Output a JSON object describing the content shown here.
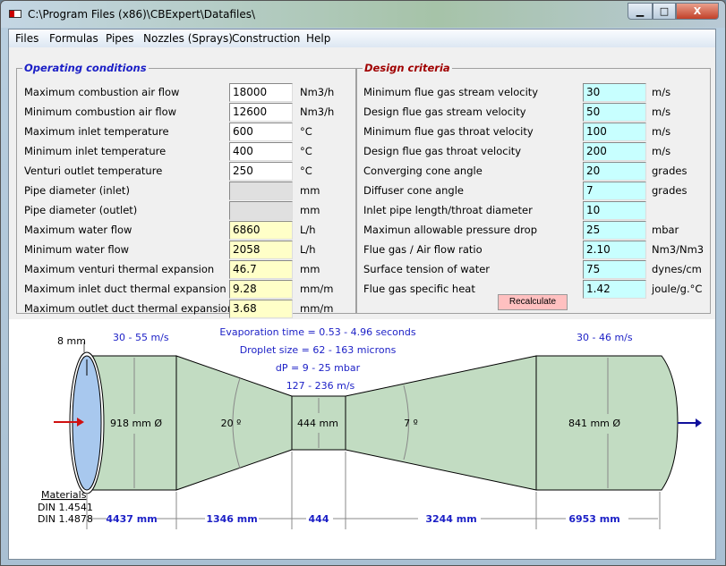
{
  "window": {
    "title": "C:\\Program Files (x86)\\CBExpert\\Datafiles\\",
    "minimize": "▁",
    "maximize": "□",
    "close": "X"
  },
  "menu": [
    "Files",
    "Formulas",
    "Pipes",
    "Nozzles (Sprays)",
    "Construction",
    "Help"
  ],
  "operating": {
    "title": "Operating conditions",
    "rows": [
      {
        "label": "Maximum combustion air flow",
        "value": "18000",
        "unit": "Nm3/h",
        "style": "white"
      },
      {
        "label": "Minimum combustion air flow",
        "value": "12600",
        "unit": "Nm3/h",
        "style": "white"
      },
      {
        "label": "Maximum inlet temperature",
        "value": "600",
        "unit": "°C",
        "style": "white"
      },
      {
        "label": "Minimum inlet temperature",
        "value": "400",
        "unit": "°C",
        "style": "white"
      },
      {
        "label": "Venturi outlet temperature",
        "value": "250",
        "unit": "°C",
        "style": "white"
      },
      {
        "label": "Pipe diameter (inlet)",
        "value": "",
        "unit": "mm",
        "style": "gray"
      },
      {
        "label": "Pipe diameter (outlet)",
        "value": "",
        "unit": "mm",
        "style": "gray"
      },
      {
        "label": "Maximum water flow",
        "value": "6860",
        "unit": "L/h",
        "style": "yellow"
      },
      {
        "label": "Minimum water flow",
        "value": "2058",
        "unit": "L/h",
        "style": "yellow"
      },
      {
        "label": "Maximum venturi thermal expansion",
        "value": "46.7",
        "unit": "mm",
        "style": "yellow"
      },
      {
        "label": "Maximum inlet duct thermal expansion",
        "value": "9.28",
        "unit": "mm/m",
        "style": "yellow"
      },
      {
        "label": "Maximum outlet duct thermal expansion",
        "value": "3.68",
        "unit": "mm/m",
        "style": "yellow"
      }
    ]
  },
  "design": {
    "title": "Design criteria",
    "rows": [
      {
        "label": "Minimum flue gas stream velocity",
        "value": "30",
        "unit": "m/s"
      },
      {
        "label": "Design flue gas stream velocity",
        "value": "50",
        "unit": "m/s"
      },
      {
        "label": "Minimum flue gas throat velocity",
        "value": "100",
        "unit": "m/s"
      },
      {
        "label": "Design flue gas throat velocity",
        "value": "200",
        "unit": "m/s"
      },
      {
        "label": "Converging cone angle",
        "value": "20",
        "unit": "grades"
      },
      {
        "label": "Diffuser cone angle",
        "value": "7",
        "unit": "grades"
      },
      {
        "label": "Inlet pipe length/throat diameter",
        "value": "10",
        "unit": ""
      },
      {
        "label": "Maximun allowable pressure drop",
        "value": "25",
        "unit": "mbar"
      },
      {
        "label": "Flue gas / Air flow ratio",
        "value": "2.10",
        "unit": "Nm3/Nm3"
      },
      {
        "label": "Surface tension of water",
        "value": "75",
        "unit": "dynes/cm"
      },
      {
        "label": "Flue gas specific heat",
        "value": "1.42",
        "unit": "joule/g.°C"
      }
    ],
    "recalculate": "Recalculate"
  },
  "diagram": {
    "wall": "8 mm",
    "inlet_velocity": "30 - 55 m/s",
    "outlet_velocity": "30 - 46 m/s",
    "evaporation": "Evaporation time = 0.53 - 4.96 seconds",
    "droplet": "Droplet size = 62 - 163 microns",
    "dp": "dP = 9 - 25 mbar",
    "throat_velocity": "127 - 236 m/s",
    "inlet_diameter": "918 mm Ø",
    "converging_angle": "20 º",
    "throat_diameter": "444 mm",
    "diffuser_angle": "7 º",
    "outlet_diameter": "841 mm Ø",
    "materials_title": "Materials",
    "materials": [
      "DIN 1.4541",
      "DIN 1.4878"
    ],
    "lengths": [
      "4437 mm",
      "1346 mm",
      "444",
      "3244 mm",
      "6953 mm"
    ],
    "colors": {
      "duct": "#c2dcc2",
      "inlet_face": "#a8c8ee",
      "dimension": "#1b1fc6",
      "inlet_arrow": "#d01010",
      "outlet_arrow": "#10109c"
    }
  }
}
